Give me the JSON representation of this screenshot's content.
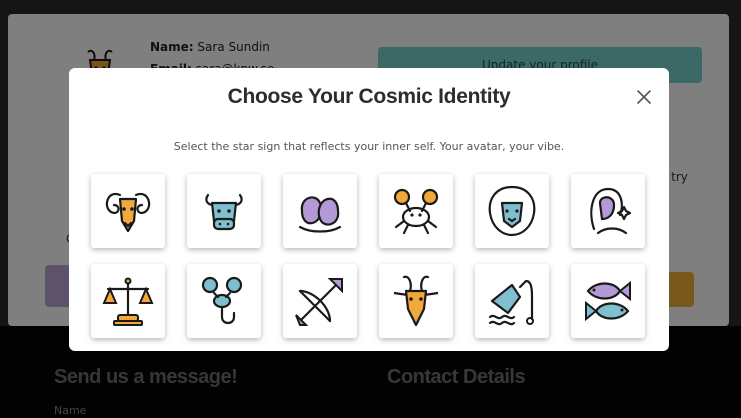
{
  "profile": {
    "name_label": "Name:",
    "name_value": "Sara Sundin",
    "email_label": "Email:",
    "email_value": "sara@kpw.se"
  },
  "background": {
    "update_button": "Update your profile",
    "partial_text": "o try",
    "partial_left": "C"
  },
  "footer": {
    "message_heading": "Send us a message!",
    "contact_heading": "Contact Details",
    "name_label": "Name"
  },
  "modal": {
    "title": "Choose Your Cosmic Identity",
    "subtitle": "Select the star sign that reflects your inner self. Your avatar, your vibe.",
    "signs": [
      {
        "name": "aries",
        "icon": "ram-icon",
        "color": "#f2a93b"
      },
      {
        "name": "taurus",
        "icon": "bull-icon",
        "color": "#7fbfd0"
      },
      {
        "name": "gemini",
        "icon": "twins-icon",
        "color": "#b39ad6"
      },
      {
        "name": "cancer",
        "icon": "crab-icon",
        "color": "#f2a93b"
      },
      {
        "name": "leo",
        "icon": "lion-icon",
        "color": "#7fbfd0"
      },
      {
        "name": "virgo",
        "icon": "maiden-icon",
        "color": "#b39ad6"
      },
      {
        "name": "libra",
        "icon": "scales-icon",
        "color": "#f2a93b"
      },
      {
        "name": "scorpio",
        "icon": "scorpion-icon",
        "color": "#7fbfd0"
      },
      {
        "name": "sagittarius",
        "icon": "archer-icon",
        "color": "#b39ad6"
      },
      {
        "name": "capricorn",
        "icon": "goat-icon",
        "color": "#f2a93b"
      },
      {
        "name": "aquarius",
        "icon": "water-bearer-icon",
        "color": "#7fbfd0"
      },
      {
        "name": "pisces",
        "icon": "fish-icon",
        "color": "#b39ad6"
      }
    ]
  }
}
